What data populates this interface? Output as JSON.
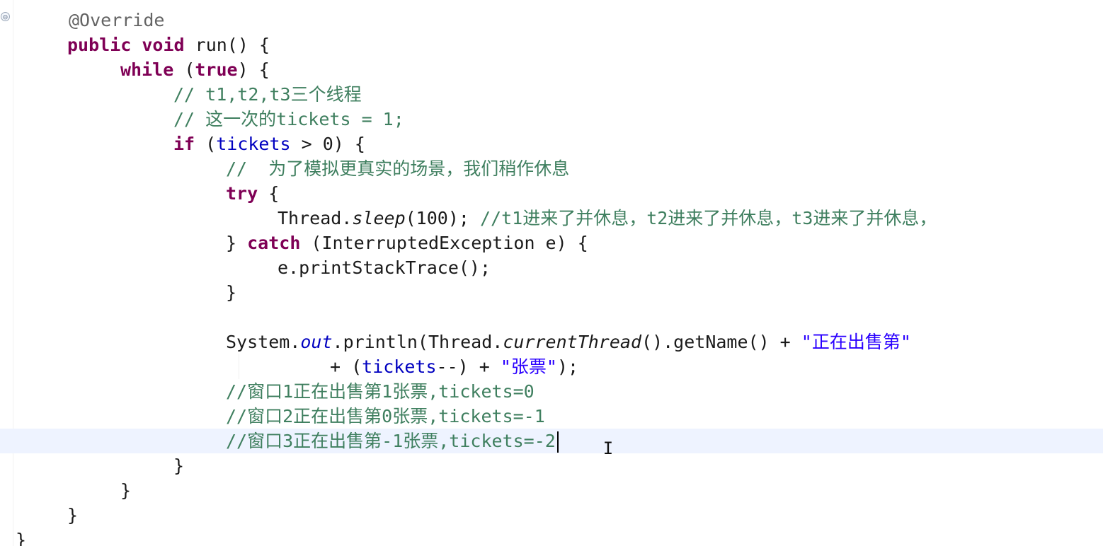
{
  "editor": {
    "fold_icon": "⊖",
    "cursor_icon": "I-beam-cursor",
    "lines": {
      "l1": "@Override",
      "l2_kw1": "public",
      "l2_kw2": "void",
      "l2_rest": " run() {",
      "l3_kw": "while",
      "l3_open": " (",
      "l3_true": "true",
      "l3_rest": ") {",
      "l4": "// t1,t2,t3三个线程",
      "l5": "// 这一次的tickets = 1;",
      "l6_kw": "if",
      "l6_open": " (",
      "l6_field": "tickets",
      "l6_rest": " > 0) {",
      "l7": "//  为了模拟更真实的场景，我们稍作休息",
      "l8_kw": "try",
      "l8_rest": " {",
      "l9_pre": "Thread.",
      "l9_method": "sleep",
      "l9_post": "(100); ",
      "l9_comment": "//t1进来了并休息，t2进来了并休息，t3进来了并休息，",
      "l10_pre": "} ",
      "l10_kw": "catch",
      "l10_rest": " (InterruptedException e) {",
      "l11": "e.printStackTrace();",
      "l12": "}",
      "l13_pre": "System.",
      "l13_out": "out",
      "l13_mid": ".println(Thread.",
      "l13_method": "currentThread",
      "l13_post": "().getName() + ",
      "l13_str": "\"正在出售第\"",
      "l14_pre": "+ (",
      "l14_field": "tickets",
      "l14_mid": "--) + ",
      "l14_str": "\"张票\"",
      "l14_post": ");",
      "l15": "//窗口1正在出售第1张票,tickets=0",
      "l16": "//窗口2正在出售第0张票,tickets=-1",
      "l17": "//窗口3正在出售第-1张票,tickets=-2",
      "l18": "}",
      "l19": "}",
      "l20": "}",
      "l21": "}"
    }
  }
}
